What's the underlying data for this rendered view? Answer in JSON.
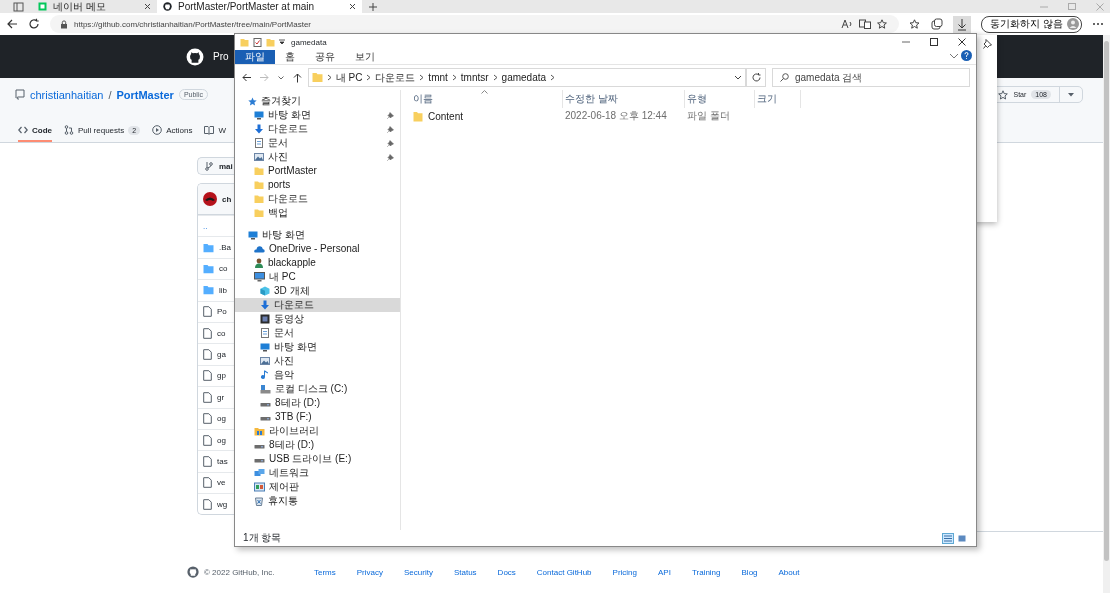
{
  "browser": {
    "tabs": [
      {
        "title": "네이버 메모",
        "selected": false
      },
      {
        "title": "PortMaster/PortMaster at main",
        "selected": true
      }
    ],
    "url": "https://github.com/christianhaitian/PortMaster/tree/main/PortMaster",
    "sync_button": "동기화하지 않음"
  },
  "github": {
    "header_text": "Pro",
    "owner": "christianhaitian",
    "separator": "/",
    "repo": "PortMaster",
    "visibility": "Public",
    "tabs": [
      {
        "label": "Code",
        "selected": true
      },
      {
        "label": "Pull requests",
        "counter": "2",
        "selected": false
      },
      {
        "label": "Actions",
        "selected": false
      },
      {
        "label": "W",
        "selected": false
      }
    ],
    "star": {
      "label": "Star",
      "count": "108"
    },
    "branch": "mai",
    "commit_author": "ch",
    "files": [
      {
        "name": "..",
        "kind": "parent"
      },
      {
        "name": ".Ba",
        "kind": "folder"
      },
      {
        "name": "co",
        "kind": "folder"
      },
      {
        "name": "lib",
        "kind": "folder"
      },
      {
        "name": "Po",
        "kind": "file"
      },
      {
        "name": "co",
        "kind": "file"
      },
      {
        "name": "ga",
        "kind": "file"
      },
      {
        "name": "gp",
        "kind": "file"
      },
      {
        "name": "gr",
        "kind": "file"
      },
      {
        "name": "og",
        "kind": "file"
      },
      {
        "name": "og",
        "kind": "file"
      },
      {
        "name": "tas",
        "kind": "file"
      },
      {
        "name": "ve",
        "kind": "file"
      },
      {
        "name": "wg",
        "kind": "file"
      }
    ],
    "footer": {
      "copyright": "© 2022 GitHub, Inc.",
      "links": [
        "Terms",
        "Privacy",
        "Security",
        "Status",
        "Docs",
        "Contact GitHub",
        "Pricing",
        "API",
        "Training",
        "Blog",
        "About"
      ]
    }
  },
  "explorer": {
    "title": "gamedata",
    "ribbon_tabs": [
      {
        "label": "파일",
        "selected": true
      },
      {
        "label": "홈",
        "selected": false
      },
      {
        "label": "공유",
        "selected": false
      },
      {
        "label": "보기",
        "selected": false
      }
    ],
    "breadcrumb": [
      "내 PC",
      "다운로드",
      "tmnt",
      "tmntsr",
      "gamedata"
    ],
    "search": {
      "placeholder": "gamedata 검색"
    },
    "sidebar": [
      {
        "label": "즐겨찾기",
        "kind": "star",
        "selected": false,
        "children": [
          {
            "label": "바탕 화면",
            "kind": "desktop",
            "pinned": true,
            "selected": false
          },
          {
            "label": "다운로드",
            "kind": "download",
            "pinned": true,
            "selected": false
          },
          {
            "label": "문서",
            "kind": "document",
            "pinned": true,
            "selected": false
          },
          {
            "label": "사진",
            "kind": "picture",
            "pinned": true,
            "selected": false
          },
          {
            "label": "PortMaster",
            "kind": "folder",
            "pinned": false,
            "selected": false
          },
          {
            "label": "ports",
            "kind": "folder",
            "pinned": false,
            "selected": false
          },
          {
            "label": "다운로드",
            "kind": "folder",
            "pinned": false,
            "selected": false
          },
          {
            "label": "백업",
            "kind": "folder",
            "pinned": false,
            "selected": false
          }
        ]
      },
      {
        "label": "바탕 화면",
        "kind": "desktop",
        "selected": false,
        "children": [
          {
            "label": "OneDrive - Personal",
            "kind": "cloud",
            "selected": false
          },
          {
            "label": "blackapple",
            "kind": "user",
            "selected": false
          },
          {
            "label": "내 PC",
            "kind": "pc",
            "selected": false,
            "children": [
              {
                "label": "3D 개체",
                "kind": "cube",
                "selected": false
              },
              {
                "label": "다운로드",
                "kind": "download",
                "selected": true
              },
              {
                "label": "동영상",
                "kind": "video",
                "selected": false
              },
              {
                "label": "문서",
                "kind": "document",
                "selected": false
              },
              {
                "label": "바탕 화면",
                "kind": "desktop",
                "selected": false
              },
              {
                "label": "사진",
                "kind": "picture",
                "selected": false
              },
              {
                "label": "음악",
                "kind": "music",
                "selected": false
              },
              {
                "label": "로컬 디스크 (C:)",
                "kind": "disk",
                "selected": false
              },
              {
                "label": "8테라 (D:)",
                "kind": "drive",
                "selected": false
              },
              {
                "label": "3TB (F:)",
                "kind": "drive",
                "selected": false
              }
            ]
          },
          {
            "label": "라이브러리",
            "kind": "library",
            "selected": false
          },
          {
            "label": "8테라 (D:)",
            "kind": "drive",
            "selected": false
          },
          {
            "label": "USB 드라이브 (E:)",
            "kind": "drive",
            "selected": false
          },
          {
            "label": "네트워크",
            "kind": "network",
            "selected": false
          },
          {
            "label": "제어판",
            "kind": "control",
            "selected": false
          },
          {
            "label": "휴지통",
            "kind": "trash",
            "selected": false
          }
        ]
      }
    ],
    "columns": [
      "이름",
      "수정한 날짜",
      "유형",
      "크기"
    ],
    "rows": [
      {
        "name": "Content",
        "modified": "2022-06-18 오후 12:44",
        "type": "파일 폴더",
        "selected": false
      }
    ],
    "status": "1개 항목",
    "views": [
      {
        "kind": "details",
        "selected": true
      },
      {
        "kind": "tiles",
        "selected": false
      }
    ]
  }
}
